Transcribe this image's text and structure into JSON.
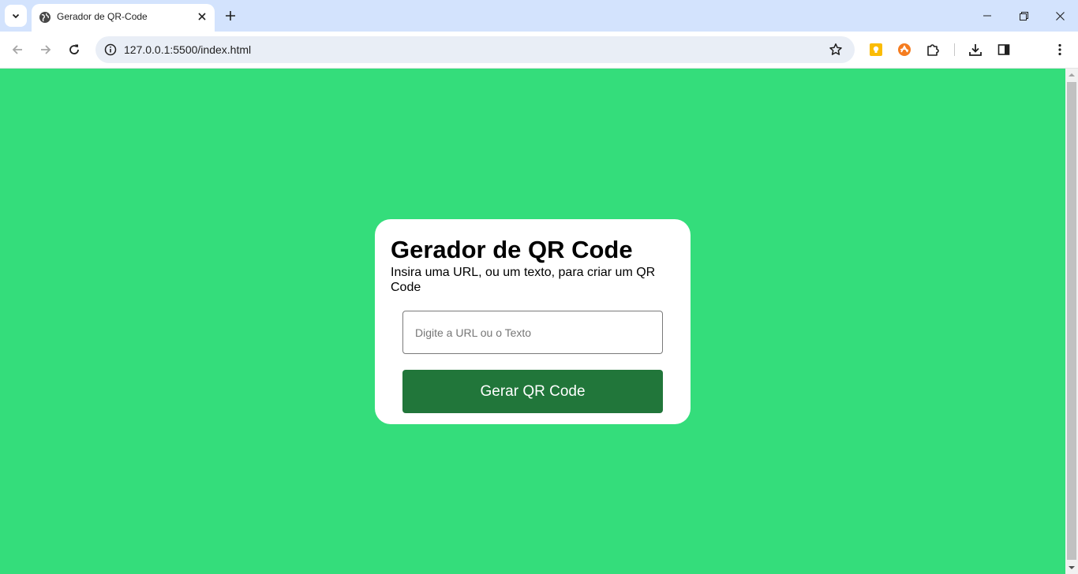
{
  "browser": {
    "tab_title": "Gerador de QR-Code",
    "url": "127.0.0.1:5500/index.html"
  },
  "page": {
    "title": "Gerador de QR Code",
    "subtitle": "Insira uma URL, ou um texto, para criar um QR Code",
    "input_placeholder": "Digite a URL ou o Texto",
    "input_value": "",
    "button_label": "Gerar QR Code"
  },
  "colors": {
    "page_background": "#34dd7b",
    "button_background": "#21763a",
    "tabstrip": "#d3e3fd"
  },
  "icons": {
    "tab_search": "chevron-down-icon",
    "favicon": "globe-icon",
    "tab_close": "close-icon",
    "new_tab": "plus-icon",
    "back": "arrow-left-icon",
    "forward": "arrow-right-icon",
    "reload": "reload-icon",
    "site_info": "info-icon",
    "bookmark": "star-icon",
    "extension_1": "keep-extension-icon",
    "extension_2": "orange-extension-icon",
    "extensions": "puzzle-icon",
    "downloads": "download-icon",
    "side_panel": "side-panel-icon",
    "menu": "kebab-menu-icon"
  }
}
